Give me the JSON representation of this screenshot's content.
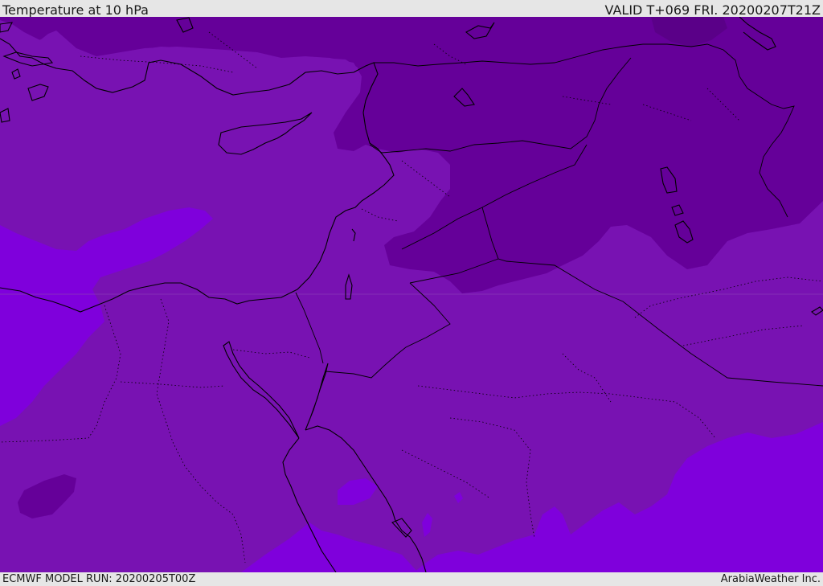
{
  "header": {
    "title": "Temperature at 10 hPa",
    "valid": "VALID T+069 FRI. 20200207T21Z"
  },
  "footer": {
    "model_run": "ECMWF MODEL RUN: 20200205T00Z",
    "credit": "ArabiaWeather Inc."
  },
  "colors": {
    "deep_purple": "#650099",
    "mid_purple": "#7812b2",
    "bright_violet": "#7f00dc",
    "coastline": "#000000",
    "background": "#e6e6e6"
  }
}
